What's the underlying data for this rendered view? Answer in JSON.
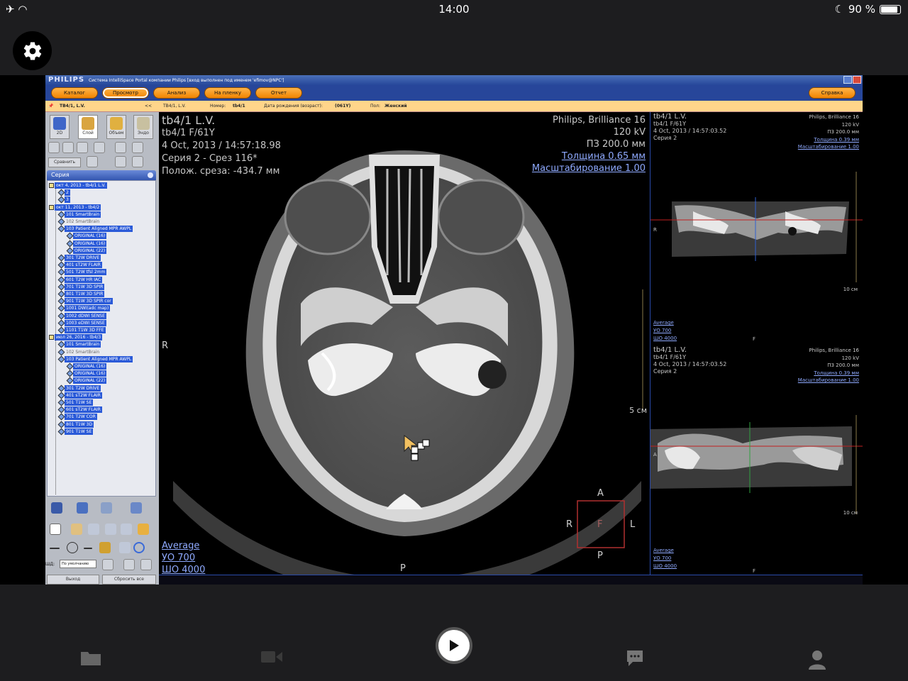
{
  "status_bar": {
    "time": "14:00",
    "battery_label": "90 %",
    "battery_level": 0.9
  },
  "app": {
    "brand": "PHILIPS",
    "title": "Система IntelliSpace Portal компании Philips [вход выполнен под именем 'efimov@NPC']",
    "menu": {
      "catalog": "Каталог",
      "view": "Просмотр",
      "analysis": "Анализ",
      "to_film": "На пленку",
      "report": "Отчет",
      "help": "Справка"
    },
    "patient_bar": {
      "patient_id": "TB4/1, L.V.",
      "collapse": "<<",
      "patient_name": "TB4/1, L.V.",
      "number_label": "Номер:",
      "number_value": "tb4/1",
      "dob_label": "Дата рождения (возраст):",
      "dob_value": "(061Y)",
      "sex_label": "Пол:",
      "sex_value": "Женский"
    },
    "tools": {
      "btn_2d": "2D",
      "btn_layer": "Слой",
      "btn_volume": "Объем",
      "btn_endo": "Эндо",
      "compare": "Сравнить"
    },
    "series_header": "Серия",
    "tree": [
      {
        "label": "окт 4, 2013 - tb4/1 L.V.",
        "level": 0
      },
      {
        "label": "2",
        "level": 1
      },
      {
        "label": "3",
        "level": 1
      },
      {
        "label": "окт 11, 2013 - tb4/2",
        "level": 0
      },
      {
        "label": "101 SmartBrain",
        "level": 1
      },
      {
        "label": "102 SmartBrain",
        "level": 1,
        "plain": true
      },
      {
        "label": "103 Patient Aligned MPR AWPL",
        "level": 1
      },
      {
        "label": "ORIGINAL (16)",
        "level": 2
      },
      {
        "label": "ORIGINAL (16)",
        "level": 2
      },
      {
        "label": "ORIGINAL (22)",
        "level": 2
      },
      {
        "label": "301 T2W DRIVE",
        "level": 1
      },
      {
        "label": "401 sT2W FLAIR",
        "level": 1
      },
      {
        "label": "501 T2W tfsl 2mm",
        "level": 1
      },
      {
        "label": "601 T2W HR IAC",
        "level": 1
      },
      {
        "label": "701 T1W 3D SPIR",
        "level": 1
      },
      {
        "label": "801 T1W 3D SPIR",
        "level": 1
      },
      {
        "label": "901 T1W 3D SPIR cor",
        "level": 1
      },
      {
        "label": "1001 DWI(adc map)",
        "level": 1
      },
      {
        "label": "1002 dDWI SENSE",
        "level": 1
      },
      {
        "label": "1003 eDWI SENSE",
        "level": 1
      },
      {
        "label": "1101 T1W 3D FFE",
        "level": 1
      },
      {
        "label": "июл 26, 2016 - tb4/3",
        "level": 0
      },
      {
        "label": "101 SmartBrain",
        "level": 1
      },
      {
        "label": "102 SmartBrain",
        "level": 1,
        "plain": true
      },
      {
        "label": "103 Patient Aligned MPR AWPL",
        "level": 1
      },
      {
        "label": "ORIGINAL (16)",
        "level": 2
      },
      {
        "label": "ORIGINAL (16)",
        "level": 2
      },
      {
        "label": "ORIGINAL (22)",
        "level": 2
      },
      {
        "label": "301 T2W DRIVE",
        "level": 1
      },
      {
        "label": "401 sT2W FLAIR",
        "level": 1
      },
      {
        "label": "501 T1W SE",
        "level": 1
      },
      {
        "label": "601 sT2W FLAIR",
        "level": 1
      },
      {
        "label": "701 T2W COR",
        "level": 1
      },
      {
        "label": "801 T1W 3D",
        "level": 1
      },
      {
        "label": "901 T1W SE",
        "level": 1
      }
    ],
    "shd_label": "ШД:",
    "shd_select": "По умолчанию",
    "exit_button": "Выход",
    "reset_button": "Сбросить все"
  },
  "main_view": {
    "patient": "tb4/1 L.V.",
    "patient_code": "tb4/1 F/61Y",
    "datetime": "4 Oct, 2013 / 14:57:18.98",
    "series_slice": "Серия 2 - Срез 116*",
    "slice_position": "Полож. среза: -434.7 мм",
    "scanner": "Philips, Brilliance 16",
    "kv": "120 kV",
    "fov": "ПЗ 200.0 мм",
    "thickness": "Толщина 0.65 мм",
    "zoom": "Масштабирование 1.00",
    "window_mode": "Average",
    "window_level": "УО   700",
    "window_width": "ШО  4000",
    "scale": "5 см",
    "orient_right": "R",
    "orient_posterior": "P",
    "cube": {
      "a": "A",
      "r": "R",
      "l": "L",
      "p": "P",
      "f": "F"
    }
  },
  "side_views": [
    {
      "patient": "tb4/1 L.V.",
      "patient_code": "tb4/1 F/61Y",
      "datetime": "4 Oct, 2013 / 14:57:03.52",
      "series": "Серия 2",
      "scanner": "Philips, Brilliance 16",
      "kv": "120 kV",
      "fov": "ПЗ 200.0 мм",
      "thickness": "Толщина 0.39 мм",
      "zoom": "Масштабирование 1.00",
      "window_mode": "Average",
      "window_level": "УО   700",
      "window_width": "ШО  4000",
      "scale": "10 см",
      "orient_r": "R",
      "orient_f": "F"
    },
    {
      "patient": "tb4/1 L.V.",
      "patient_code": "tb4/1 F/61Y",
      "datetime": "4 Oct, 2013 / 14:57:03.52",
      "series": "Серия 2",
      "scanner": "Philips, Brilliance 16",
      "kv": "120 kV",
      "fov": "ПЗ 200.0 мм",
      "thickness": "Толщина 0.39 мм",
      "zoom": "Масштабирование 1.00",
      "window_mode": "Average",
      "window_level": "УО   700",
      "window_width": "ШО  4000",
      "scale": "10 см",
      "orient_a": "A",
      "orient_f": "F"
    }
  ],
  "colors": {
    "accent_orange": "#f08400",
    "title_blue": "#27469a",
    "selection_blue": "#2a5ad8",
    "link_blue": "#8faaff"
  }
}
